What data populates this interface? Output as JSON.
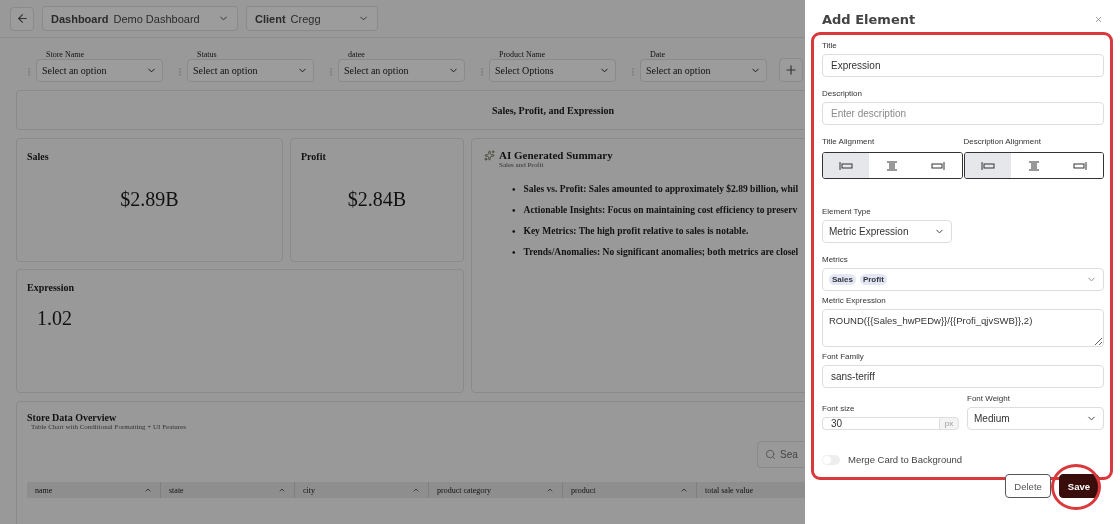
{
  "topbar": {
    "selectors": [
      {
        "label": "Dashboard",
        "value": "Demo Dashboard"
      },
      {
        "label": "Client",
        "value": "Cregg"
      }
    ]
  },
  "filters": [
    {
      "label": "Store Name",
      "placeholder": "Select an option"
    },
    {
      "label": "Status",
      "placeholder": "Select an option"
    },
    {
      "label": "datee",
      "placeholder": "Select an option"
    },
    {
      "label": "Product Name",
      "placeholder": "Select Options"
    },
    {
      "label": "Date",
      "placeholder": "Select an option"
    }
  ],
  "title_card": {
    "title": "Sales, Profit, and Expression"
  },
  "metric_cards": [
    {
      "title": "Sales",
      "value": "$2.89B"
    },
    {
      "title": "Profit",
      "value": "$2.84B"
    }
  ],
  "expression_card": {
    "title": "Expression",
    "value": "1.02"
  },
  "summary": {
    "title": "AI Generated Summary",
    "subtitle": "Sales and Profit",
    "marker": "•",
    "bullets": [
      "Sales vs. Profit: Sales amounted to approximately $2.89 billion, whil",
      "Actionable Insights: Focus on maintaining cost efficiency to preserv",
      "Key Metrics: The high profit relative to sales is notable.",
      "Trends/Anomalies: No significant anomalies; both metrics are closel"
    ]
  },
  "table_section": {
    "title": "Store Data Overview",
    "subtitle": "Table Chart with Conditional Formatting + UI Features",
    "search": {
      "placeholder": "Sea"
    },
    "columns": [
      "name",
      "state",
      "city",
      "product category",
      "product",
      "total sale value"
    ]
  },
  "drawer": {
    "title": "Add Element",
    "title_field": {
      "label": "Title",
      "value": "Expression"
    },
    "description_field": {
      "label": "Description",
      "placeholder": "Enter description"
    },
    "alignments": [
      {
        "label": "Title Alignment",
        "options": [
          {
            "kind": "left",
            "selected": true
          },
          {
            "kind": "center",
            "selected": false
          },
          {
            "kind": "right",
            "selected": false
          }
        ]
      },
      {
        "label": "Description Alignment",
        "options": [
          {
            "kind": "left",
            "selected": true
          },
          {
            "kind": "center",
            "selected": false
          },
          {
            "kind": "right",
            "selected": false
          }
        ]
      }
    ],
    "element_type": {
      "label": "Element Type",
      "value": "Metric Expression"
    },
    "metrics": {
      "label": "Metrics",
      "tags": [
        "Sales",
        "Profit"
      ]
    },
    "metric_expression": {
      "label": "Metric Expression",
      "value": "ROUND({{Sales_hwPEDw}}/{{Profi_qjvSWB}},2)"
    },
    "font_family": {
      "label": "Font Family",
      "value": "sans-teriff"
    },
    "font_size": {
      "label": "Font size",
      "value": "30",
      "unit": "px"
    },
    "font_weight": {
      "label": "Font Weight",
      "value": "Medium"
    },
    "merge_toggle": {
      "label": "Merge Card to Background",
      "on": false
    },
    "buttons": [
      {
        "label": "Delete",
        "kind": "secondary",
        "highlighted": false
      },
      {
        "label": "Save",
        "kind": "primary",
        "highlighted": true
      }
    ]
  }
}
